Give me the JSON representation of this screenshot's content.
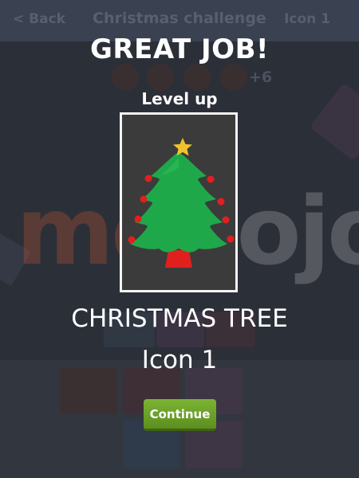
{
  "background": {
    "back_label": "< Back",
    "title": "Christmas challenge",
    "level_label": "Icon 1",
    "bonus": "+6"
  },
  "watermark": {
    "part1": "mo",
    "part2": "dojo"
  },
  "overlay": {
    "headline": "GREAT JOB!",
    "subhead": "Level up",
    "icon_name": "CHRISTMAS TREE",
    "icon_number": "Icon 1",
    "continue_label": "Continue",
    "icon": "christmas-tree-icon"
  },
  "colors": {
    "tree_green": "#1fa84a",
    "ornament_red": "#e0201e",
    "star_gold": "#f2c12e",
    "button_green": "#6aa128"
  }
}
